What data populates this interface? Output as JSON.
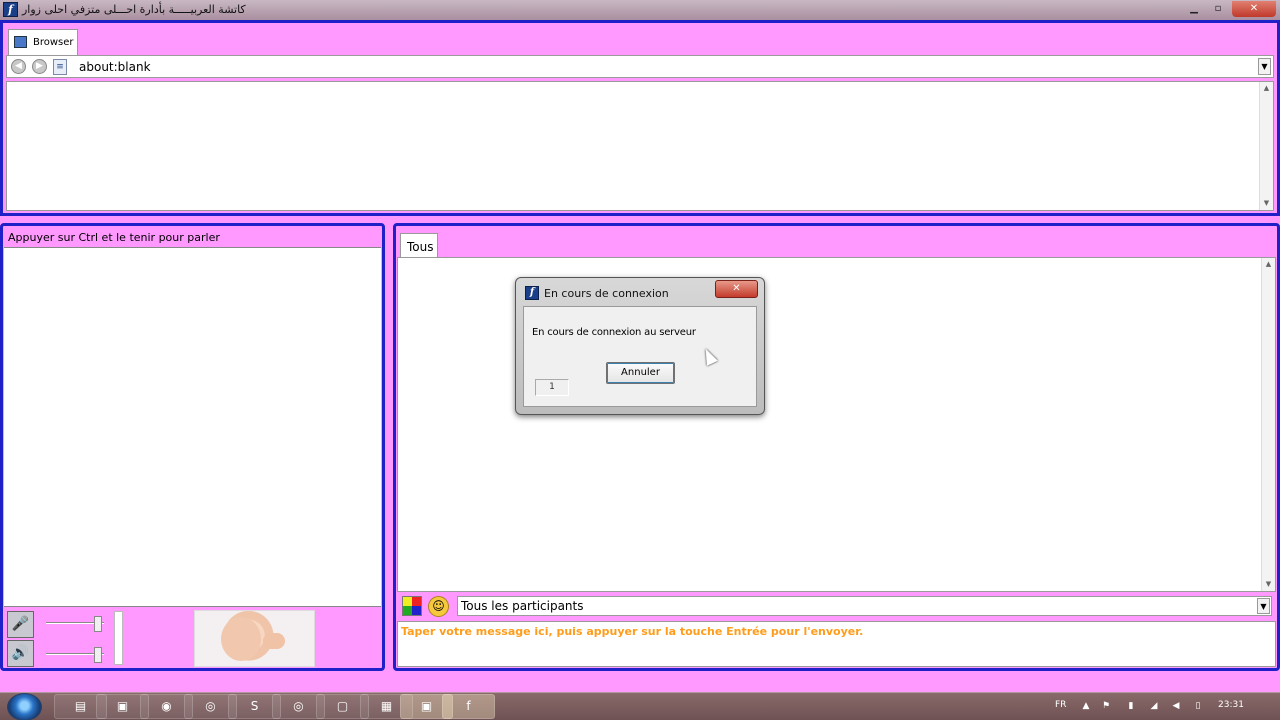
{
  "window": {
    "title": "كاتشة العربيـــــة بأدارة احـــلى متزفي احلى زوار"
  },
  "browser": {
    "tab_label": "Browser",
    "url_value": "about:blank"
  },
  "left_panel": {
    "ptt_label": "Appuyer sur Ctrl et le tenir pour parler"
  },
  "chat": {
    "tab_label": "Tous",
    "recipient_value": "Tous les participants",
    "message_placeholder": "Taper votre message ici, puis appuyer sur la touche Entrée pour l'envoyer.",
    "placeholder_color": "#ff9c1a"
  },
  "dialog": {
    "title": "En cours de connexion",
    "message": "En cours de connexion au serveur",
    "cancel_label": "Annuler",
    "counter": "1"
  },
  "taskbar": {
    "language": "FR",
    "clock": "23:31"
  },
  "colors": {
    "panel_background": "#ff99ff",
    "panel_border": "#2020c8"
  }
}
